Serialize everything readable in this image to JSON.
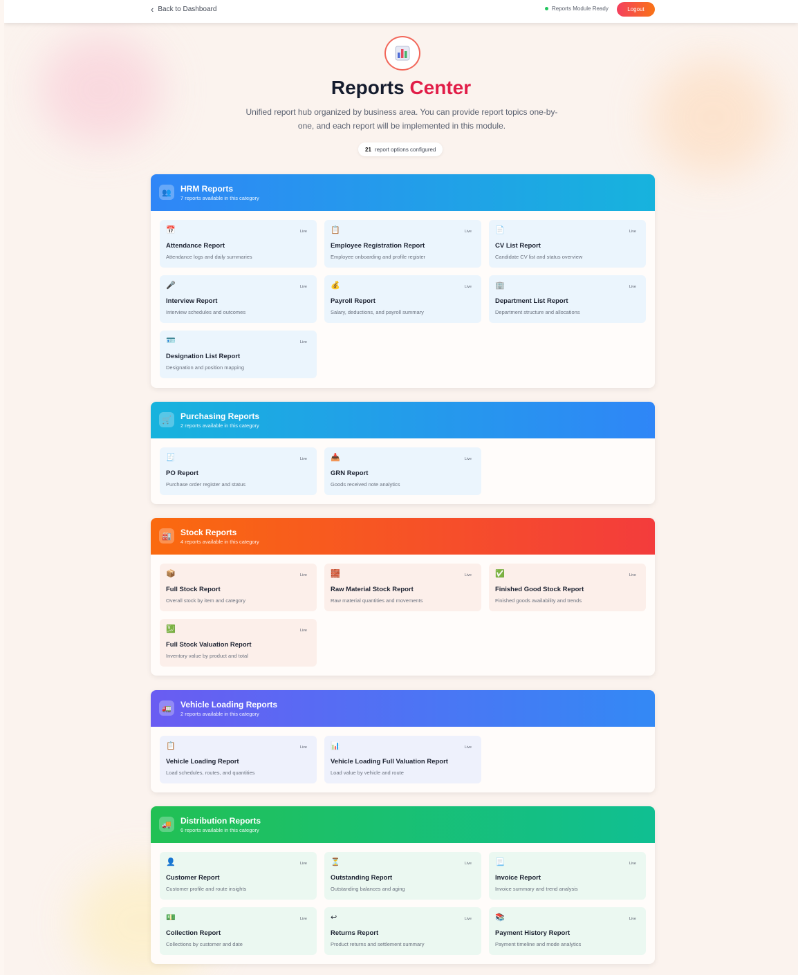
{
  "topbar": {
    "back_label": "Back to Dashboard",
    "status_label": "Reports Module Ready",
    "logout_label": "Logout"
  },
  "hero": {
    "title_main": "Reports",
    "title_accent": "Center",
    "subtitle": "Unified report hub organized by business area. You can provide report topics one-by-one, and each report will be implemented in this module.",
    "count_value": "21",
    "count_label": "report options configured"
  },
  "categories": [
    {
      "title": "HRM Reports",
      "count_text": "7 reports available in this category",
      "icon": "users-icon",
      "reports": [
        {
          "icon": "calendar-icon",
          "title": "Attendance Report",
          "desc": "Attendance logs and daily summaries",
          "badge": "Live"
        },
        {
          "icon": "clipboard-icon",
          "title": "Employee Registration Report",
          "desc": "Employee onboarding and profile register",
          "badge": "Live"
        },
        {
          "icon": "document-icon",
          "title": "CV List Report",
          "desc": "Candidate CV list and status overview",
          "badge": "Live"
        },
        {
          "icon": "microphone-icon",
          "title": "Interview Report",
          "desc": "Interview schedules and outcomes",
          "badge": "Live"
        },
        {
          "icon": "money-bag-icon",
          "title": "Payroll Report",
          "desc": "Salary, deductions, and payroll summary",
          "badge": "Live"
        },
        {
          "icon": "building-icon",
          "title": "Department List Report",
          "desc": "Department structure and allocations",
          "badge": "Live"
        },
        {
          "icon": "id-badge-icon",
          "title": "Designation List Report",
          "desc": "Designation and position mapping",
          "badge": "Live"
        }
      ]
    },
    {
      "title": "Purchasing Reports",
      "count_text": "2 reports available in this category",
      "icon": "cart-icon",
      "reports": [
        {
          "icon": "receipt-icon",
          "title": "PO Report",
          "desc": "Purchase order register and status",
          "badge": "Live"
        },
        {
          "icon": "inbox-icon",
          "title": "GRN Report",
          "desc": "Goods received note analytics",
          "badge": "Live"
        }
      ]
    },
    {
      "title": "Stock Reports",
      "count_text": "4 reports available in this category",
      "icon": "warehouse-icon",
      "reports": [
        {
          "icon": "box-icon",
          "title": "Full Stock Report",
          "desc": "Overall stock by item and category",
          "badge": "Live"
        },
        {
          "icon": "bricks-icon",
          "title": "Raw Material Stock Report",
          "desc": "Raw material quantities and movements",
          "badge": "Live"
        },
        {
          "icon": "check-box-icon",
          "title": "Finished Good Stock Report",
          "desc": "Finished goods availability and trends",
          "badge": "Live"
        },
        {
          "icon": "valuation-icon",
          "title": "Full Stock Valuation Report",
          "desc": "Inventory value by product and total",
          "badge": "Live"
        }
      ]
    },
    {
      "title": "Vehicle Loading Reports",
      "count_text": "2 reports available in this category",
      "icon": "truck-icon",
      "reports": [
        {
          "icon": "clipboard-icon",
          "title": "Vehicle Loading Report",
          "desc": "Load schedules, routes, and quantities",
          "badge": "Live"
        },
        {
          "icon": "chart-icon",
          "title": "Vehicle Loading Full Valuation Report",
          "desc": "Load value by vehicle and route",
          "badge": "Live"
        }
      ]
    },
    {
      "title": "Distribution Reports",
      "count_text": "6 reports available in this category",
      "icon": "delivery-truck-icon",
      "reports": [
        {
          "icon": "person-icon",
          "title": "Customer Report",
          "desc": "Customer profile and route insights",
          "badge": "Live"
        },
        {
          "icon": "hourglass-icon",
          "title": "Outstanding Report",
          "desc": "Outstanding balances and aging",
          "badge": "Live"
        },
        {
          "icon": "invoice-icon",
          "title": "Invoice Report",
          "desc": "Invoice summary and trend analysis",
          "badge": "Live"
        },
        {
          "icon": "cash-icon",
          "title": "Collection Report",
          "desc": "Collections by customer and date",
          "badge": "Live"
        },
        {
          "icon": "return-icon",
          "title": "Returns Report",
          "desc": "Product returns and settlement summary",
          "badge": "Live"
        },
        {
          "icon": "books-icon",
          "title": "Payment History Report",
          "desc": "Payment timeline and mode analytics",
          "badge": "Live"
        }
      ]
    }
  ]
}
